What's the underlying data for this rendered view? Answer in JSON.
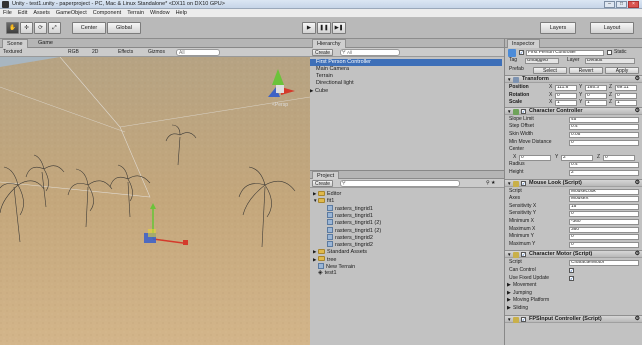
{
  "window": {
    "title": "Unity - test1.unity - paperproject - PC, Mac & Linux Standalone* <DX11 on DX10 GPU>",
    "controls": [
      "–",
      "□",
      "×"
    ]
  },
  "menu": [
    "File",
    "Edit",
    "Assets",
    "GameObject",
    "Component",
    "Terrain",
    "Window",
    "Help"
  ],
  "toolbar": {
    "tools": [
      "✋",
      "✢",
      "⟳",
      "⤢"
    ],
    "pivot": "Center",
    "space": "Global",
    "play": "▶",
    "pause": "❚❚",
    "step": "▶❚",
    "layers": "Layers",
    "layout": "Layout"
  },
  "scene": {
    "tabs": [
      "Scene",
      "Game"
    ],
    "shading": "Textured",
    "render": "RGB",
    "mode2d": "2D",
    "effects": "Effects",
    "gizmos": "Gizmos",
    "search": "All",
    "persp": "<Persp"
  },
  "hierarchy": {
    "title": "Hierarchy",
    "create": "Create",
    "search": "All",
    "items": [
      "First Person Controller",
      "Main Camera",
      "Terrain",
      "Directional light",
      "Cube"
    ],
    "selected": 0
  },
  "project": {
    "title": "Project",
    "create": "Create",
    "items": [
      {
        "label": "Editor",
        "type": "folder",
        "indent": 0,
        "arrow": "▶"
      },
      {
        "label": "fit1",
        "type": "folder",
        "indent": 0,
        "arrow": "▼"
      },
      {
        "label": "rasters_tingrid1",
        "type": "file",
        "indent": 1
      },
      {
        "label": "rasters_tingrid1",
        "type": "file",
        "indent": 1
      },
      {
        "label": "rasters_tingrid1 (2)",
        "type": "file",
        "indent": 1
      },
      {
        "label": "rasters_tingrid1 (2)",
        "type": "file",
        "indent": 1
      },
      {
        "label": "rasters_tingrid2",
        "type": "file",
        "indent": 1
      },
      {
        "label": "rasters_tingrid2",
        "type": "file",
        "indent": 1
      },
      {
        "label": "Standard Assets",
        "type": "folder",
        "indent": 0,
        "arrow": "▶"
      },
      {
        "label": "tree",
        "type": "folder",
        "indent": 0,
        "arrow": "▶"
      },
      {
        "label": "New Terrain",
        "type": "file",
        "indent": 0
      },
      {
        "label": "test1",
        "type": "unity",
        "indent": 0
      }
    ]
  },
  "inspector": {
    "title": "Inspector",
    "object_name": "First Person Controller",
    "static": "Static",
    "tag_label": "Tag",
    "tag": "Untagged",
    "layer_label": "Layer",
    "layer": "Default",
    "prefab": "Prefab",
    "select": "Select",
    "revert": "Revert",
    "apply": "Apply",
    "transform": {
      "title": "Transform",
      "rows": [
        {
          "label": "Position",
          "x": "111.8",
          "y": "185.3",
          "z": "69.11"
        },
        {
          "label": "Rotation",
          "x": "0",
          "y": "0",
          "z": "0"
        },
        {
          "label": "Scale",
          "x": "1",
          "y": "1",
          "z": "1"
        }
      ]
    },
    "cc": {
      "title": "Character Controller",
      "rows": [
        {
          "label": "Slope Limit",
          "value": "45"
        },
        {
          "label": "Step Offset",
          "value": "0.4"
        },
        {
          "label": "Skin Width",
          "value": "0.05"
        },
        {
          "label": "Min Move Distance",
          "value": "0"
        }
      ],
      "center": "Center",
      "cx": "0",
      "cy": "2",
      "cz": "0",
      "radius_label": "Radius",
      "radius": "0.4",
      "height_label": "Height",
      "height": "2"
    },
    "ml": {
      "title": "Mouse Look (Script)",
      "script_label": "Script",
      "script": "MouseLook",
      "axes_label": "Axes",
      "axes": "MouseX",
      "rows": [
        {
          "label": "Sensitivity X",
          "value": "15"
        },
        {
          "label": "Sensitivity Y",
          "value": "0"
        },
        {
          "label": "Minimum X",
          "value": "-360"
        },
        {
          "label": "Maximum X",
          "value": "360"
        },
        {
          "label": "Minimum Y",
          "value": "0"
        },
        {
          "label": "Maximum Y",
          "value": "0"
        }
      ]
    },
    "cm": {
      "title": "Character Motor (Script)",
      "script_label": "Script",
      "script": "CharacterMotor",
      "can_control": "Can Control",
      "fixed_update": "Use Fixed Update",
      "sections": [
        "Movement",
        "Jumping",
        "Moving Platform",
        "Sliding"
      ]
    },
    "fps": {
      "title": "FPSInput Controller (Script)"
    }
  },
  "colors": {
    "selection": "#3d6fb8",
    "toolbar": "#b9b9b9",
    "sand": "#c9a878",
    "sky": "#a9b8c4"
  }
}
